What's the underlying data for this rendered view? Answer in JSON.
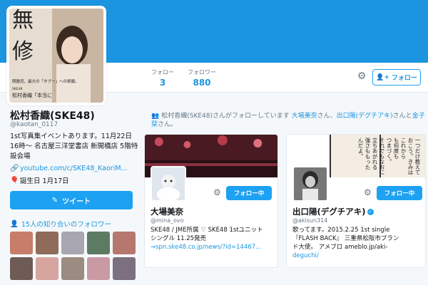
{
  "profile": {
    "name": "松村香織(SKE48)",
    "handle": "@kaotan_0117",
    "bio": "1st写真集イベントあります。11月22日16時〜 名古屋三洋堂書店 新開橋店 5階特設会場",
    "website": "youtube.com/c/SKE48_KaoriM...",
    "birthday": "誕生日 1月17日",
    "tweet_button": "ツイート",
    "known_followers": "15人の知り合いのフォロワー",
    "avatar_text": {
      "big_left": "無",
      "big_right": "修",
      "caption1": "問題児、最大の「タブー」への挑戦。",
      "caption2": "松村香織「本当に",
      "caption3": "SKE48"
    }
  },
  "stats": {
    "following_label": "フォロー",
    "following_value": "3",
    "followers_label": "フォロワー",
    "followers_value": "880"
  },
  "header_actions": {
    "follow_label": "フォロー"
  },
  "followed_line": {
    "prefix": "松村香織(SKE48)さんがフォローしています",
    "user1": "大場美奈",
    "sep1": "さん、",
    "user2": "出口陽(デグチアキ)",
    "sep2": "さんと",
    "user3": "金子栞",
    "suffix": "さん。"
  },
  "cards": [
    {
      "name": "大場美奈",
      "handle": "@mina_ovo",
      "bio1": "SKE48 / JME所属 ♡ SKE48 1stユニット",
      "bio2": "シングル 11.25発売",
      "bio3": "→spn.ske48.co.jp/news/?id=14467...",
      "follow_label": "フォロー中"
    },
    {
      "name": "出口陽(デグチアキ)",
      "handle": "@akisun314",
      "bio1": "歌ってます。2015.2.25 1st single",
      "bio2": "『FLASH BACK』 三重県松阪市ブラン",
      "bio3": "ド大使。 アメブロ ameblo.jp/aki-",
      "bio4": "deguchi/",
      "follow_label": "フォロー中",
      "manga_text": [
        "一つだけ",
        "教えて",
        "おこう。",
        "きみは",
        "これから",
        "も何度も",
        "つまづく。",
        "それでも",
        "なおに",
        "立ちあ",
        "がれる",
        "強さも",
        "もった",
        "んだよ。"
      ]
    }
  ],
  "thumb_colors": [
    "#c77d6a",
    "#8f6b5a",
    "#a8a6b0",
    "#5d7a62",
    "#b6786e",
    "#6e5b55",
    "#d7a5a0",
    "#9c8b80",
    "#c99aa4",
    "#7b6f80"
  ],
  "colors": {
    "brand": "#1da1f2",
    "banner": "#1b95e0",
    "link": "#1b95e0"
  }
}
